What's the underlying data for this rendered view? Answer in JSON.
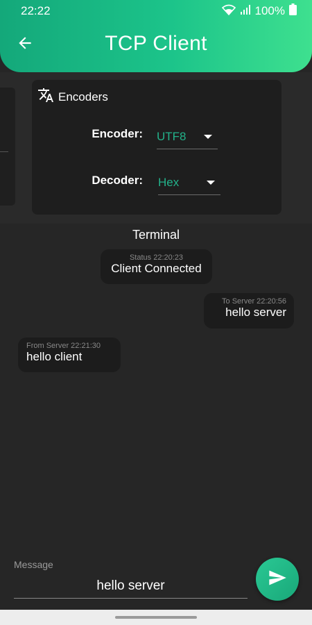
{
  "status_bar": {
    "time": "22:22",
    "battery_percent": "100%",
    "icons": [
      "wifi-icon",
      "signal-icon",
      "battery-icon"
    ]
  },
  "app_bar": {
    "title": "TCP Client",
    "back_icon": "arrow-left-icon"
  },
  "encoders": {
    "header": "Encoders",
    "header_icon": "translate-icon",
    "encoder_label": "Encoder:",
    "encoder_value": "UTF8",
    "decoder_label": "Decoder:",
    "decoder_value": "Hex"
  },
  "terminal": {
    "title": "Terminal",
    "messages": [
      {
        "meta": "Status  22:20:23",
        "text": "Client Connected",
        "align": "center"
      },
      {
        "meta": "To Server  22:20:56",
        "text": "hello server",
        "align": "right"
      },
      {
        "meta": "From Server  22:21:30",
        "text": "hello client",
        "align": "left"
      }
    ]
  },
  "composer": {
    "label": "Message",
    "value": "hello server",
    "send_icon": "send-icon"
  },
  "colors": {
    "accent": "#1cc48a",
    "value_text": "#23b28a",
    "background": "#262626",
    "card": "#1e1e1e"
  }
}
